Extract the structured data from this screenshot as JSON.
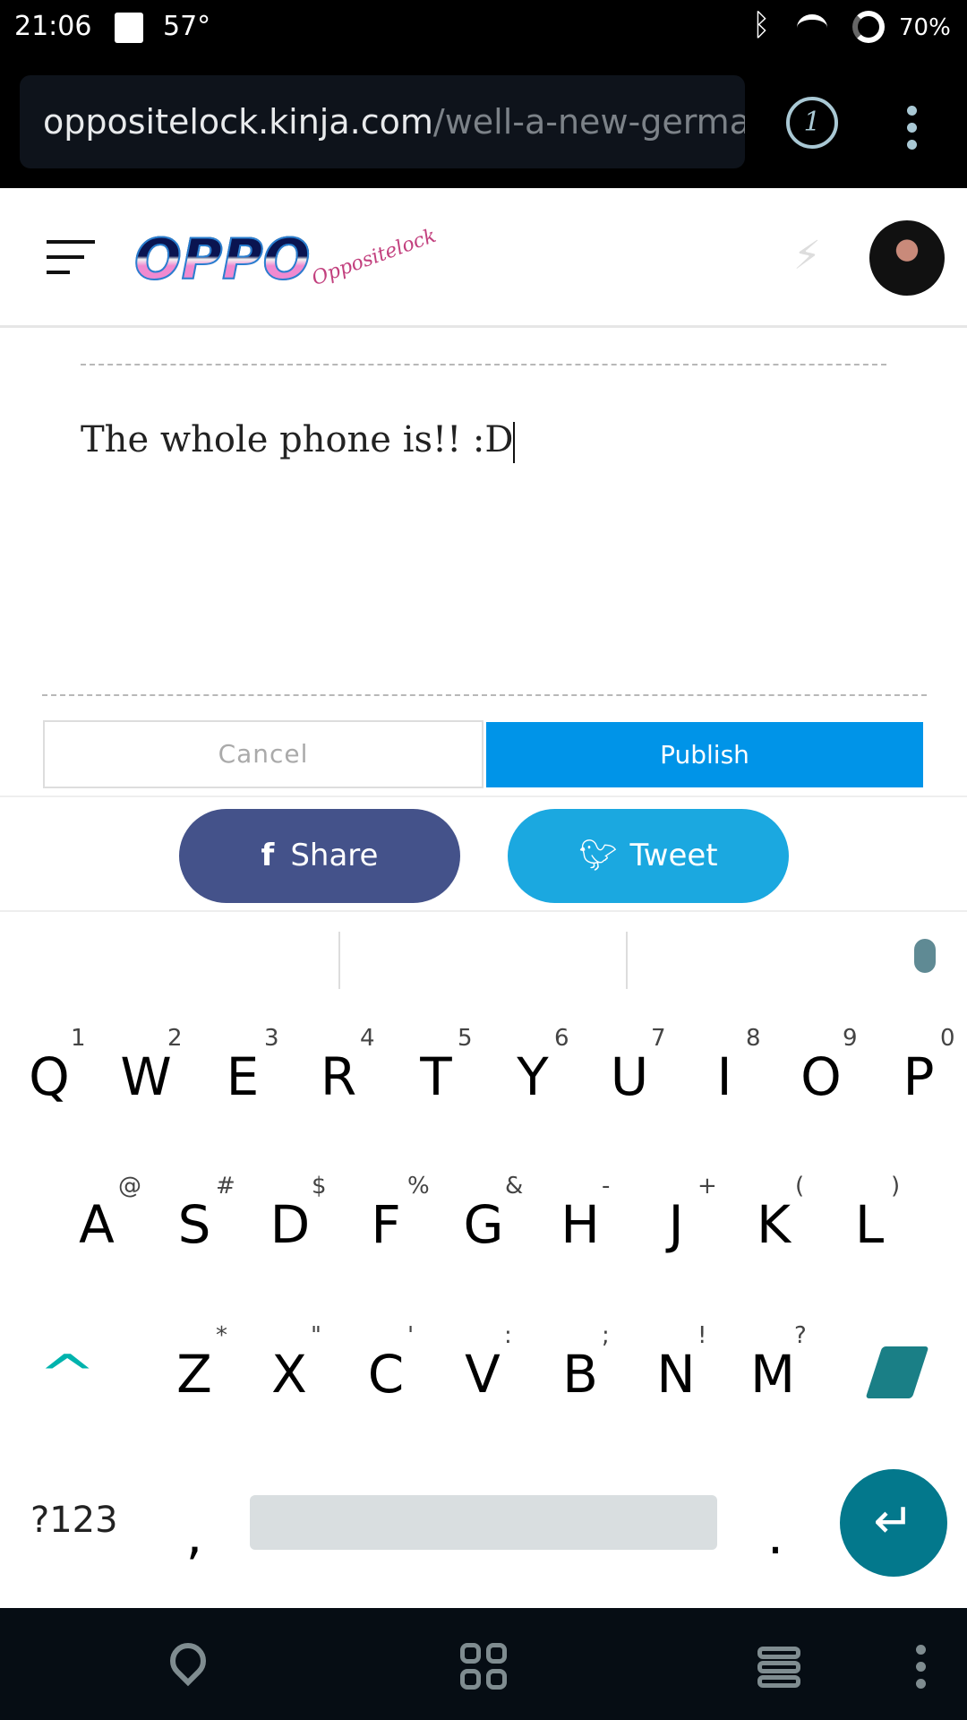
{
  "status_bar": {
    "time": "21:06",
    "temperature": "57°",
    "battery": "70%"
  },
  "browser": {
    "url_host": "oppositelock.kinja.com",
    "url_path": "/well-a-new-german-c",
    "tab_count": "1"
  },
  "header": {
    "logo_text": "OPPO",
    "logo_script": "Oppositelock"
  },
  "editor": {
    "text": "The whole phone is!! :D"
  },
  "actions": {
    "cancel": "Cancel",
    "publish": "Publish"
  },
  "share": {
    "facebook": "Share",
    "twitter": "Tweet",
    "facebook_color": "#44528a",
    "twitter_color": "#1ba8e0"
  },
  "keyboard": {
    "row1": [
      {
        "k": "Q",
        "s": "1"
      },
      {
        "k": "W",
        "s": "2"
      },
      {
        "k": "E",
        "s": "3"
      },
      {
        "k": "R",
        "s": "4"
      },
      {
        "k": "T",
        "s": "5"
      },
      {
        "k": "Y",
        "s": "6"
      },
      {
        "k": "U",
        "s": "7"
      },
      {
        "k": "I",
        "s": "8"
      },
      {
        "k": "O",
        "s": "9"
      },
      {
        "k": "P",
        "s": "0"
      }
    ],
    "row2": [
      {
        "k": "A",
        "s": "@"
      },
      {
        "k": "S",
        "s": "#"
      },
      {
        "k": "D",
        "s": "$"
      },
      {
        "k": "F",
        "s": "%"
      },
      {
        "k": "G",
        "s": "&"
      },
      {
        "k": "H",
        "s": "-"
      },
      {
        "k": "J",
        "s": "+"
      },
      {
        "k": "K",
        "s": "("
      },
      {
        "k": "L",
        "s": ")"
      }
    ],
    "row3": [
      {
        "k": "Z",
        "s": "*"
      },
      {
        "k": "X",
        "s": "\""
      },
      {
        "k": "C",
        "s": "'"
      },
      {
        "k": "V",
        "s": ":"
      },
      {
        "k": "B",
        "s": ";"
      },
      {
        "k": "N",
        "s": "!"
      },
      {
        "k": "M",
        "s": "?"
      }
    ],
    "symbols": "?123",
    "comma": ",",
    "period": ".",
    "accent": "#00b3ad",
    "enter_color": "#03788c"
  }
}
